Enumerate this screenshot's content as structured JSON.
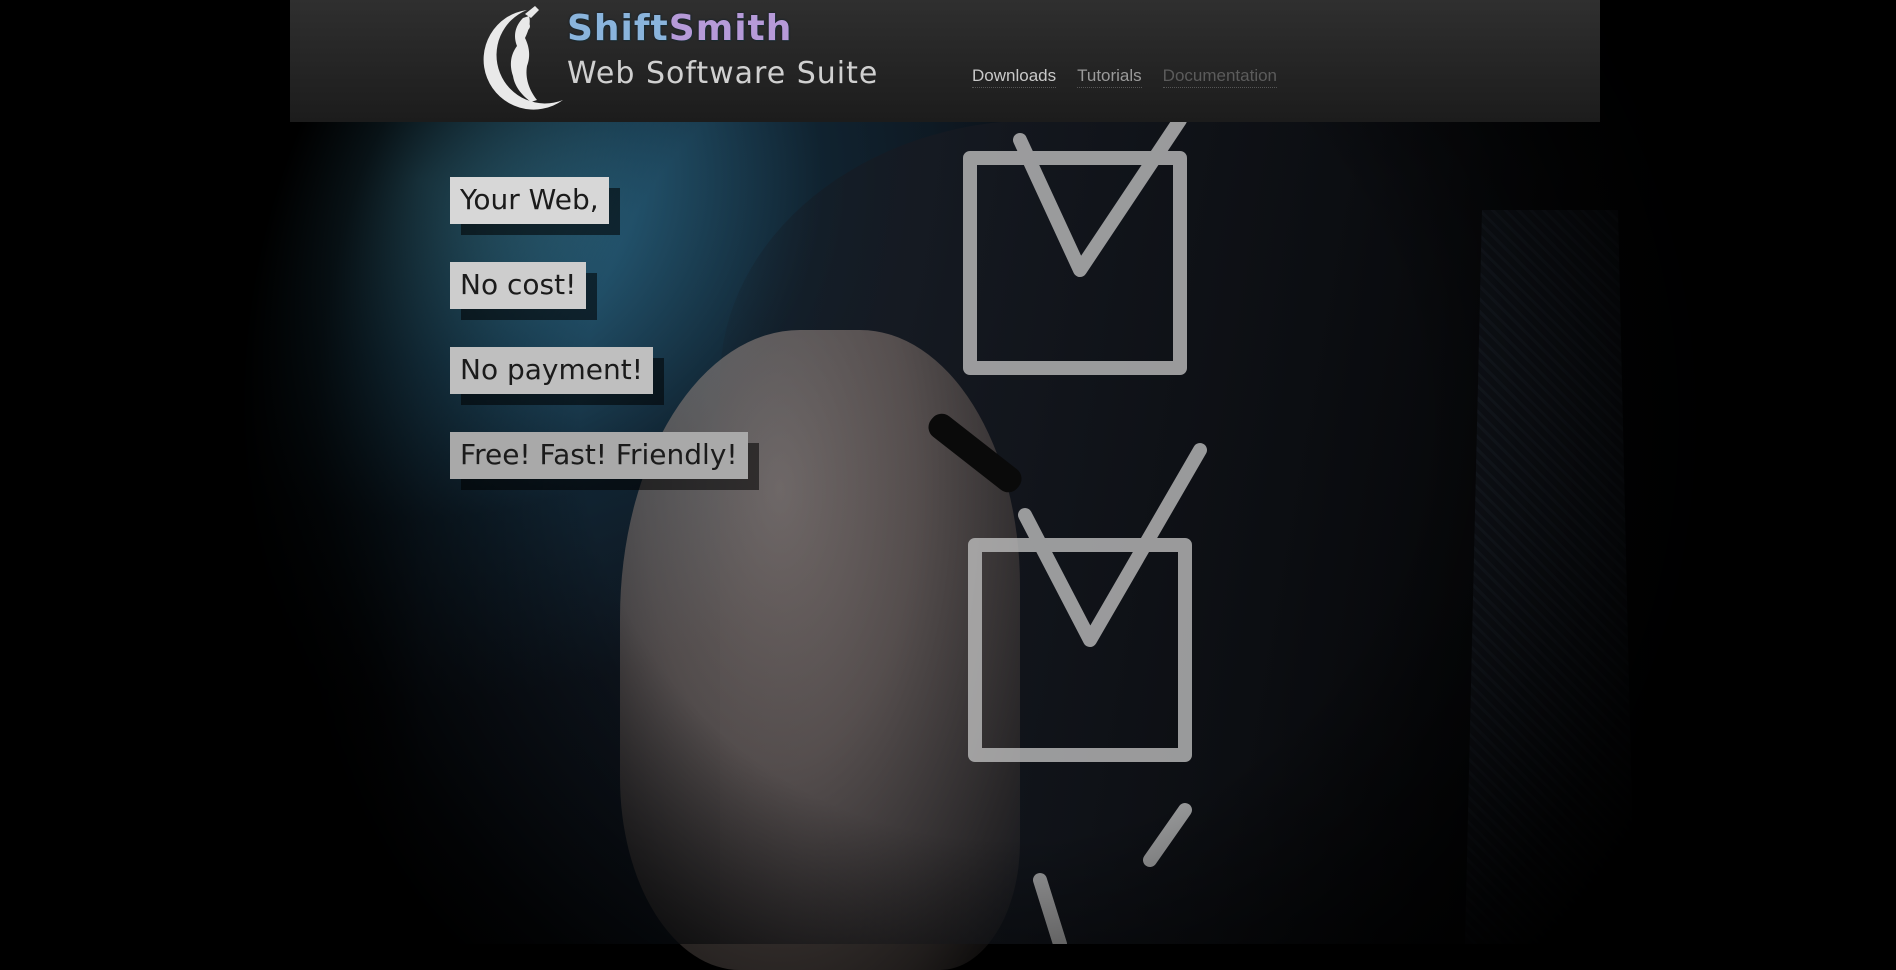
{
  "header": {
    "brand_part1": "Shift",
    "brand_part2": "Smith",
    "subtitle": "Web Software Suite",
    "logo_icon": "crescent-moon-mermaid-logo"
  },
  "nav": {
    "items": [
      {
        "label": "Downloads"
      },
      {
        "label": "Tutorials"
      },
      {
        "label": "Documentation"
      }
    ]
  },
  "hero": {
    "slogans": [
      {
        "text": "Your Web,"
      },
      {
        "text": "No cost!"
      },
      {
        "text": "No payment!"
      },
      {
        "text": "Free! Fast! Friendly!"
      }
    ],
    "background_image": "hand-drawing-checkboxes-photo"
  },
  "colors": {
    "brand_blue": "#8ab4dc",
    "brand_purple": "#b69ad8",
    "header_bg": "#262626",
    "chalk": "#cfcfcf"
  }
}
